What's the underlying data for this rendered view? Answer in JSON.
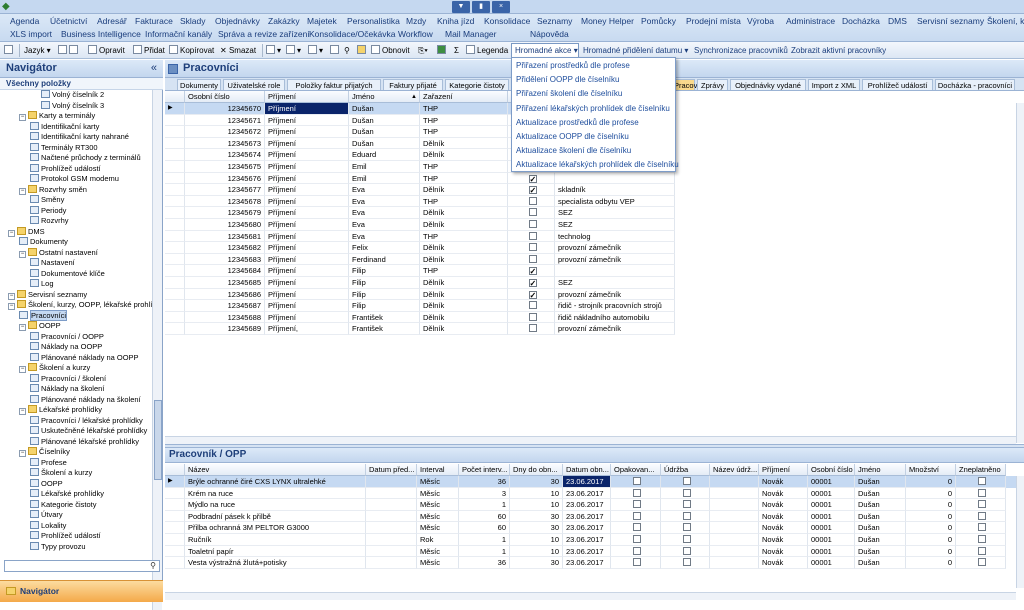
{
  "menu": {
    "row1": [
      "Agenda",
      "Účetnictví",
      "Adresář",
      "Fakturace",
      "Sklady",
      "Objednávky",
      "Zakázky",
      "Majetek",
      "Personalistika",
      "Mzdy",
      "Kniha jízd",
      "Konsolidace",
      "Seznamy",
      "Money Helper",
      "Pomůcky",
      "Prodejní místa",
      "Výroba",
      "Administrace",
      "Docházka",
      "DMS",
      "Servisní seznamy",
      "Školení, ku"
    ],
    "row2": [
      "XLS import",
      "Business Intelligence",
      "Informační kanály",
      "Správa a revize zařízení",
      "Konsolidace/Očekávka",
      "Workflow",
      "Mail Manager",
      "Nápověda"
    ]
  },
  "toolbar": {
    "jazyk": "Jazyk",
    "opravit": "Opravit",
    "pridat": "Přidat",
    "kopirovat": "Kopírovat",
    "smazat": "Smazat",
    "obnovit": "Obnovit",
    "legenda": "Legenda",
    "hromadne": "Hromadné akce",
    "hromadne_prideleni": "Hromadné přidělení datumu",
    "synchronizace": "Synchronizace pracovníků",
    "zobrazit": "Zobrazit aktivní pracovníky",
    "sigma": "Σ"
  },
  "dropdown": [
    "Přiřazení prostředků dle profese",
    "Přidělení OOPP dle číselníku",
    "Přiřazení školení dle číselníku",
    "Přiřazení lékařských prohlídek dle číselníku",
    "Aktualizace prostředků dle profese",
    "Aktualizace OOPP dle číselníku",
    "Aktualizace školení dle číselníku",
    "Aktualizace lékařských prohlídek dle číselníku"
  ],
  "navigator": {
    "title": "Navigátor",
    "collapse": "«",
    "subtitle": "Všechny položky",
    "bottom": "Navigátor",
    "items": [
      "Volný číselník 2",
      "Volný číselník 3",
      "Karty a terminály",
      "Identifikační karty",
      "Identifikační karty nahrané",
      "Terminály RT300",
      "Načtené průchody z terminálů",
      "Prohlížeč událostí",
      "Protokol GSM modemu",
      "Rozvrhy směn",
      "Směny",
      "Periody",
      "Rozvrhy",
      "DMS",
      "Dokumenty",
      "Ostatní nastavení",
      "Nastavení",
      "Dokumentové klíče",
      "Log",
      "Servisní seznamy",
      "Školení, kurzy, OOPP, lékařské prohlídky",
      "Pracovníci",
      "OOPP",
      "Pracovníci / OOPP",
      "Náklady na OOPP",
      "Plánované náklady na OOPP",
      "Školení a kurzy",
      "Pracovníci / školení",
      "Náklady na školení",
      "Plánované náklady na školení",
      "Lékařské prohlídky",
      "Pracovníci / lékařské prohlídky",
      "Uskutečněné lékařské prohlídky",
      "Plánované lékařské prohlídky",
      "Číselníky",
      "Profese",
      "Školení a kurzy",
      "OOPP",
      "Lékařské prohlídky",
      "Kategorie čistoty",
      "Útvary",
      "Lokality",
      "Prohlížeč událostí",
      "Typy provozu"
    ]
  },
  "main": {
    "title": "Pracovníci",
    "tabs": [
      "Dokumenty",
      "Uživatelské role",
      "Položky faktur přijatých",
      "Faktury přijaté",
      "Kategorie čistoty",
      "Pracovníci",
      "Zprávy",
      "Objednávky vydané",
      "Import z XML",
      "Prohlížeč událostí",
      "Docházka - pracovníci"
    ],
    "columns": [
      "Osobní číslo",
      "Příjmení",
      "Jméno",
      "Zařazení"
    ],
    "rows": [
      [
        "12345670",
        "Příjmení",
        "Dušan",
        "THP",
        "",
        ""
      ],
      [
        "12345671",
        "Příjmení",
        "Dušan",
        "THP",
        "",
        ""
      ],
      [
        "12345672",
        "Příjmení",
        "Dušan",
        "THP",
        "",
        ""
      ],
      [
        "12345673",
        "Příjmení",
        "Dušan",
        "Dělník",
        "",
        ""
      ],
      [
        "12345674",
        "Příjmení",
        "Eduard",
        "Dělník",
        "",
        ""
      ],
      [
        "12345675",
        "Příjmení",
        "Emil",
        "THP",
        "",
        ""
      ],
      [
        "12345676",
        "Příjmení",
        "Emil",
        "THP",
        "on",
        ""
      ],
      [
        "12345677",
        "Příjmení",
        "Eva",
        "Dělník",
        "on",
        "skladník"
      ],
      [
        "12345678",
        "Příjmení",
        "Eva",
        "THP",
        "off",
        "specialista odbytu VEP"
      ],
      [
        "12345679",
        "Příjmení",
        "Eva",
        "Dělník",
        "off",
        "SEZ"
      ],
      [
        "12345680",
        "Příjmení",
        "Eva",
        "Dělník",
        "off",
        "SEZ"
      ],
      [
        "12345681",
        "Příjmení",
        "Eva",
        "THP",
        "off",
        "technolog"
      ],
      [
        "12345682",
        "Příjmení",
        "Felix",
        "Dělník",
        "off",
        "provozní zámečník"
      ],
      [
        "12345683",
        "Příjmení",
        "Ferdinand",
        "Dělník",
        "off",
        "provozní zámečník"
      ],
      [
        "12345684",
        "Příjmení",
        "Filip",
        "THP",
        "on",
        ""
      ],
      [
        "12345685",
        "Příjmení",
        "Filip",
        "Dělník",
        "on",
        "SEZ"
      ],
      [
        "12345686",
        "Příjmení",
        "Filip",
        "Dělník",
        "on",
        "provozní zámečník"
      ],
      [
        "12345687",
        "Příjmení",
        "Filip",
        "Dělník",
        "off",
        "řidič - strojník pracovních strojů"
      ],
      [
        "12345688",
        "Příjmení",
        "František",
        "Dělník",
        "off",
        "řidič nákladního automobilu"
      ],
      [
        "12345689",
        "Příjmení,",
        "František",
        "Dělník",
        "off",
        "provozní zámečník"
      ]
    ]
  },
  "sub": {
    "title": "Pracovník / OPP",
    "columns": [
      "Název",
      "Datum před...",
      "Interval",
      "Počet interv...",
      "Dny do obn...",
      "Datum obn...",
      "Opakovan...",
      "Údržba",
      "Název údrž...",
      "Příjmení",
      "Osobní číslo",
      "Jméno",
      "Množství",
      "Zneplatněno"
    ],
    "rows": [
      [
        "Brýle ochranné čiré CXS LYNX ultralehké",
        "Měsíc",
        "36",
        "30",
        "23.06.2017",
        "Novák",
        "00001",
        "Dušan",
        "0"
      ],
      [
        "Krém na ruce",
        "Měsíc",
        "3",
        "10",
        "23.06.2017",
        "Novák",
        "00001",
        "Dušan",
        "0"
      ],
      [
        "Mýdlo na ruce",
        "Měsíc",
        "1",
        "10",
        "23.06.2017",
        "Novák",
        "00001",
        "Dušan",
        "0"
      ],
      [
        "Podbradní pásek k přilbě",
        "Měsíc",
        "60",
        "30",
        "23.06.2017",
        "Novák",
        "00001",
        "Dušan",
        "0"
      ],
      [
        "Přilba ochranná 3M PELTOR G3000",
        "Měsíc",
        "60",
        "30",
        "23.06.2017",
        "Novák",
        "00001",
        "Dušan",
        "0"
      ],
      [
        "Ručník",
        "Rok",
        "1",
        "10",
        "23.06.2017",
        "Novák",
        "00001",
        "Dušan",
        "0"
      ],
      [
        "Toaletní papír",
        "Měsíc",
        "1",
        "10",
        "23.06.2017",
        "Novák",
        "00001",
        "Dušan",
        "0"
      ],
      [
        "Vesta výstražná žlutá+potisky",
        "Měsíc",
        "36",
        "30",
        "23.06.2017",
        "Novák",
        "00001",
        "Dušan",
        "0"
      ]
    ]
  },
  "colors": {
    "accent": "#1e3f7a",
    "selection": "#0a246a",
    "navbottom": "#f4a94a"
  }
}
